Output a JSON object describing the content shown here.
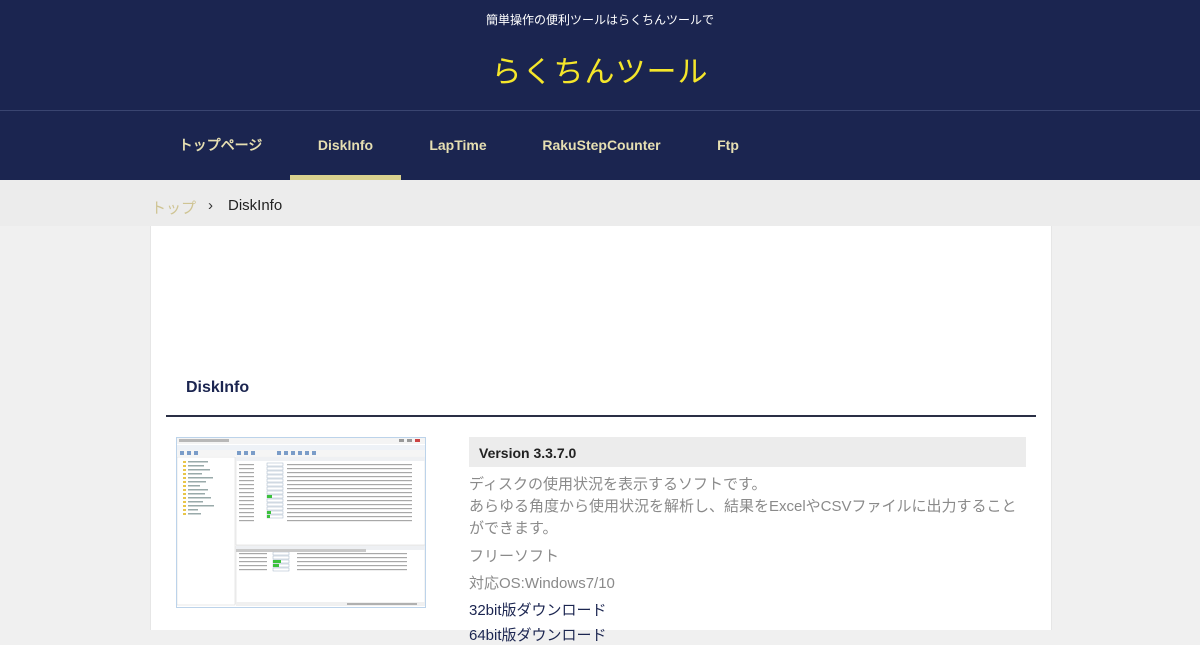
{
  "header": {
    "tagline": "簡単操作の便利ツールはらくちんツールで",
    "site_title": "らくちんツール"
  },
  "nav": {
    "items": [
      {
        "label": "トップページ"
      },
      {
        "label": "DiskInfo"
      },
      {
        "label": "LapTime"
      },
      {
        "label": "RakuStepCounter"
      },
      {
        "label": "Ftp"
      }
    ],
    "active": "DiskInfo"
  },
  "breadcrumb": {
    "home": "トップ",
    "separator": "›",
    "current": "DiskInfo"
  },
  "section": {
    "title": "DiskInfo",
    "version": "Version 3.3.7.0",
    "description_1": "ディスクの使用状況を表示するソフトです。",
    "description_2": "あらゆる角度から使用状況を解析し、結果をExcelやCSVファイルに出力することができます。",
    "license": "フリーソフト",
    "os": "対応OS:Windows7/10",
    "download_32": "32bit版ダウンロード",
    "download_64": "64bit版ダウンロード"
  },
  "colors": {
    "header_bg": "#1b2550",
    "title_yellow": "#f5e62a",
    "nav_text": "#e6dfb2",
    "active_underline": "#d9d18e"
  }
}
